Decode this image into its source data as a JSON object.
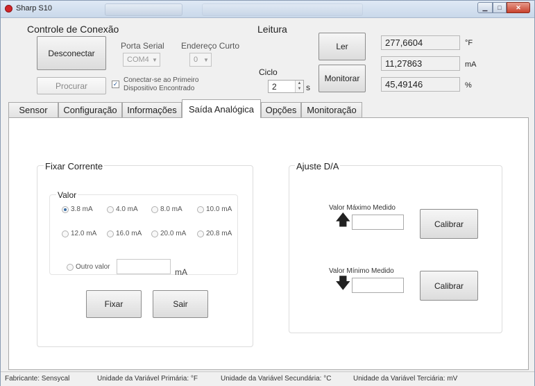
{
  "window": {
    "title": "Sharp S10"
  },
  "connection": {
    "group_title": "Controle de Conexão",
    "disconnect_label": "Desconectar",
    "search_label": "Procurar",
    "serial_port_label": "Porta Serial",
    "serial_port_value": "COM4",
    "short_address_label": "Endereço Curto",
    "short_address_value": "0",
    "auto_connect_label_1": "Conectar-se ao Primeiro",
    "auto_connect_label_2": "Dispositivo Encontrado"
  },
  "reading": {
    "group_title": "Leitura",
    "read_label": "Ler",
    "monitor_label": "Monitorar",
    "cycle_label": "Ciclo",
    "cycle_value": "2",
    "cycle_unit": "s",
    "values": [
      {
        "value": "277,6604",
        "unit": "°F"
      },
      {
        "value": "11,27863",
        "unit": "mA"
      },
      {
        "value": "45,49146",
        "unit": "%"
      }
    ]
  },
  "tabs": [
    "Sensor",
    "Configuração",
    "Informações",
    "Saída Analógica",
    "Opções",
    "Monitoração"
  ],
  "fix_current": {
    "group_title": "Fixar Corrente",
    "value_label": "Valor",
    "options": [
      "3.8 mA",
      "4.0 mA",
      "8.0 mA",
      "10.0 mA",
      "12.0 mA",
      "16.0 mA",
      "20.0 mA",
      "20.8 mA"
    ],
    "selected": "3.8 mA",
    "other_label": "Outro valor",
    "other_unit": "mA",
    "fix_label": "Fixar",
    "exit_label": "Sair"
  },
  "da_adjust": {
    "group_title": "Ajuste D/A",
    "max_label": "Valor Máximo Medido",
    "min_label": "Valor Mínimo Medido",
    "calibrate_label": "Calibrar"
  },
  "status": {
    "manufacturer": "Fabricante: Sensycal",
    "primary_unit": "Unidade da Variável Primária: °F",
    "secondary_unit": "Unidade da Variável Secundária: °C",
    "tertiary_unit": "Unidade da Variável Terciária: mV"
  }
}
